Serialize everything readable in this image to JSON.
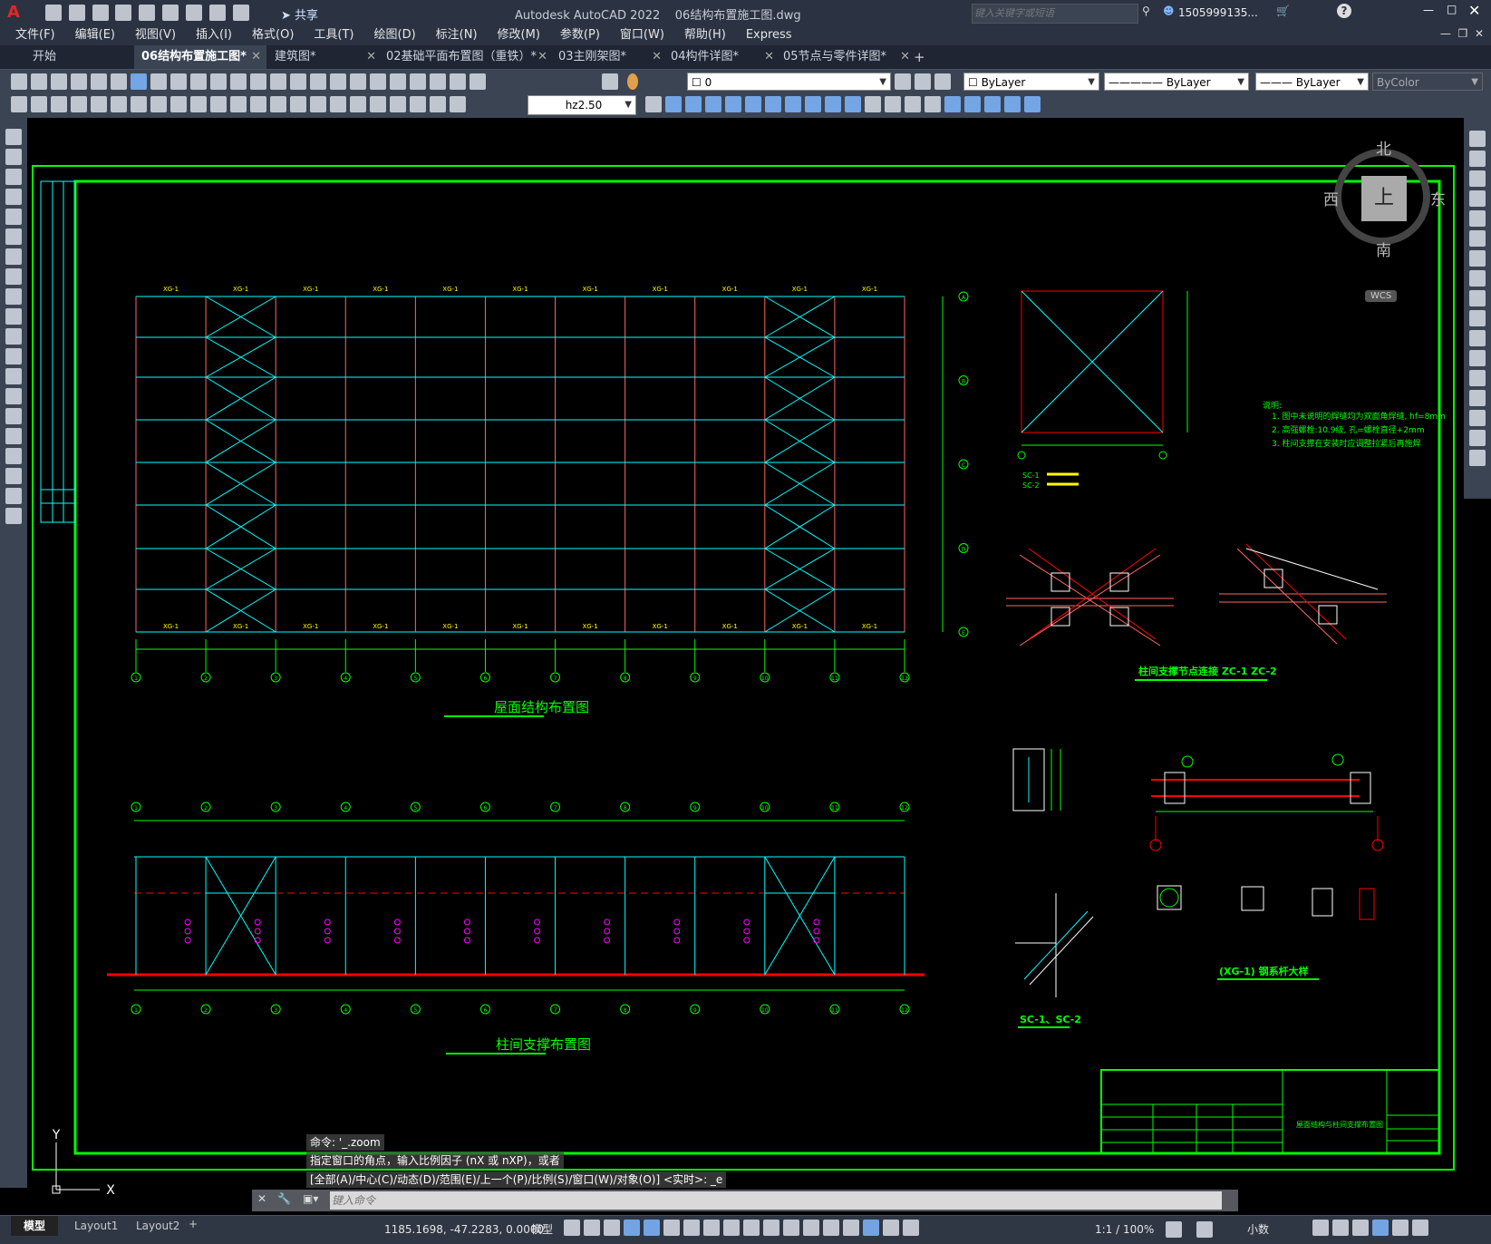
{
  "app": {
    "title": "Autodesk AutoCAD 2022",
    "filename": "06结构布置施工图.dwg",
    "share": "共享",
    "search_placeholder": "键入关键字或短语",
    "user": "1505999135...",
    "logo": "A"
  },
  "menu": [
    "文件(F)",
    "编辑(E)",
    "视图(V)",
    "插入(I)",
    "格式(O)",
    "工具(T)",
    "绘图(D)",
    "标注(N)",
    "修改(M)",
    "参数(P)",
    "窗口(W)",
    "帮助(H)",
    "Express"
  ],
  "tabs": [
    "开始",
    "06结构布置施工图*",
    "建筑图*",
    "02基础平面布置图（重铁）*",
    "03主刚架图*",
    "04构件详图*",
    "05节点与零件详图*"
  ],
  "toolbar": {
    "layer": "0",
    "color": "ByLayer",
    "linetype": "ByLayer",
    "lineweight": "ByLayer",
    "plotstyle": "ByColor",
    "textstyle": "hz2.50"
  },
  "viewcube": {
    "north": "北",
    "south": "南",
    "east": "东",
    "west": "西",
    "top": "上",
    "wcs": "WCS"
  },
  "drawing": {
    "plan_title": "屋面结构布置图",
    "elev_title": "柱间支撑布置图",
    "node_title": "柱间支撑节点连接  ZC-1  ZC-2",
    "tie_title": "(XG-1) 钢系杆大样",
    "sc_title": "SC-1、SC-2",
    "notes_head": "说明:",
    "notes": [
      "1. 图中未说明的焊缝均为双面角焊缝, hf=8mm",
      "2. 高强螺栓:10.9级, 孔=螺栓直径+2mm",
      "3. 柱间支撑在安装时应调整拉紧后再施焊"
    ],
    "legend": [
      "SC-1",
      "SC-2"
    ],
    "xg": "XG-1",
    "block_title": "屋面结构与柱间支撑布置图",
    "bays": [
      "1",
      "2",
      "3",
      "4",
      "5",
      "6",
      "7",
      "8",
      "9",
      "10",
      "11",
      "12"
    ],
    "rows": [
      "A",
      "B",
      "C",
      "D",
      "E"
    ]
  },
  "command": {
    "history1": "命令: '_.zoom",
    "history2": "指定窗口的角点，输入比例因子 (nX 或 nXP)，或者",
    "history3": "[全部(A)/中心(C)/动态(D)/范围(E)/上一个(P)/比例(S)/窗口(W)/对象(O)] <实时>: _e",
    "placeholder": "键入命令"
  },
  "status": {
    "coords": "1185.1698, -47.2283, 0.0000",
    "model": "模型",
    "layouts": [
      "模型",
      "Layout1",
      "Layout2"
    ],
    "scale": "1:1 / 100%",
    "units": "小数"
  },
  "colors": {
    "green": "#00ff00",
    "cyan": "#00ffff",
    "red": "#ff0000",
    "yellow": "#ffff00",
    "magenta": "#ff00ff",
    "white": "#ffffff"
  }
}
